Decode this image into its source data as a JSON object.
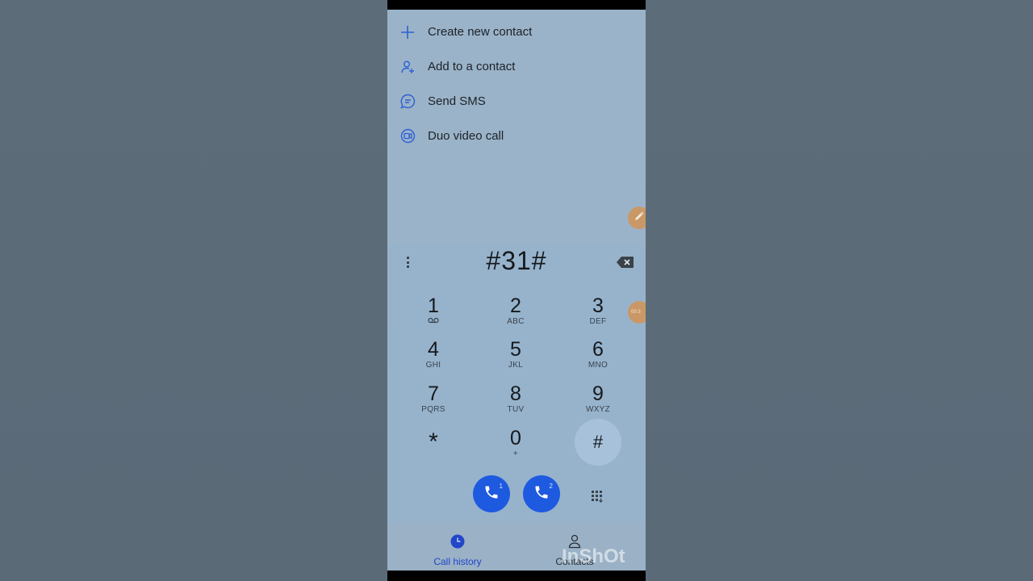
{
  "menu": {
    "items": [
      {
        "label": "Create new contact",
        "icon": "plus-icon"
      },
      {
        "label": "Add to a contact",
        "icon": "add-person-icon"
      },
      {
        "label": "Send SMS",
        "icon": "message-icon"
      },
      {
        "label": "Duo video call",
        "icon": "video-call-icon"
      }
    ]
  },
  "dialer": {
    "number": "#31#",
    "timer_text": "00:3",
    "keys": [
      {
        "digit": "1",
        "sub": "voicemail-icon"
      },
      {
        "digit": "2",
        "sub": "ABC"
      },
      {
        "digit": "3",
        "sub": "DEF"
      },
      {
        "digit": "4",
        "sub": "GHI"
      },
      {
        "digit": "5",
        "sub": "JKL"
      },
      {
        "digit": "6",
        "sub": "MNO"
      },
      {
        "digit": "7",
        "sub": "PQRS"
      },
      {
        "digit": "8",
        "sub": "TUV"
      },
      {
        "digit": "9",
        "sub": "WXYZ"
      },
      {
        "digit": "*",
        "sub": ""
      },
      {
        "digit": "0",
        "sub": "+"
      },
      {
        "digit": "#",
        "sub": ""
      }
    ],
    "sim1_label": "1",
    "sim2_label": "2"
  },
  "nav": {
    "history_label": "Call history",
    "contacts_label": "Contacts"
  },
  "watermark": "InShOt",
  "colors": {
    "accent": "#1e5ae0",
    "nav_active": "#2246c8",
    "panel": "#97b3cc",
    "fab": "#c99866"
  }
}
